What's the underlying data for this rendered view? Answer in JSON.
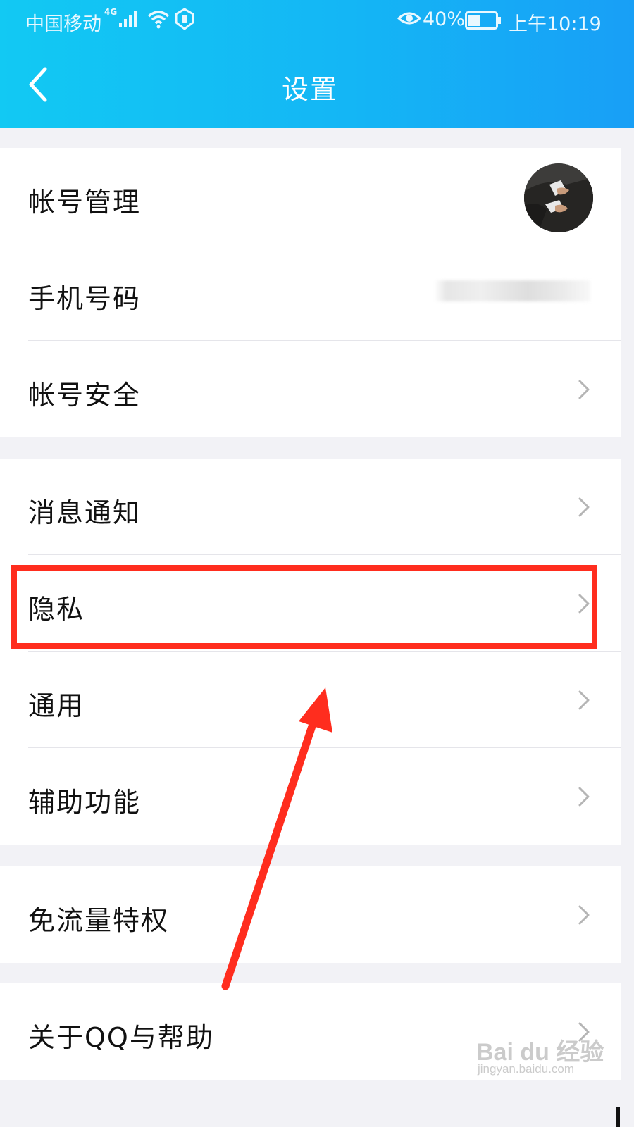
{
  "status_bar": {
    "carrier": "中国移动",
    "network": "4G",
    "battery_pct": "40%",
    "time": "上午10:19"
  },
  "nav": {
    "title": "设置",
    "back_icon": "chevron-left-icon"
  },
  "groups": [
    {
      "items": [
        {
          "label": "帐号管理",
          "accessory": "avatar"
        },
        {
          "label": "手机号码",
          "accessory": "masked-phone"
        },
        {
          "label": "帐号安全",
          "accessory": "chevron"
        }
      ]
    },
    {
      "items": [
        {
          "label": "消息通知",
          "accessory": "chevron"
        },
        {
          "label": "隐私",
          "accessory": "chevron",
          "highlighted": true
        },
        {
          "label": "通用",
          "accessory": "chevron"
        },
        {
          "label": "辅助功能",
          "accessory": "chevron"
        }
      ]
    },
    {
      "items": [
        {
          "label": "免流量特权",
          "accessory": "chevron"
        }
      ]
    },
    {
      "items": [
        {
          "label": "关于QQ与帮助",
          "accessory": "chevron"
        }
      ]
    }
  ],
  "annotation": {
    "highlight_color": "#ff2d1e",
    "arrow_color": "#ff2d1e"
  },
  "watermark": {
    "brand": "Bai du 经验",
    "url": "jingyan.baidu.com"
  },
  "colors": {
    "header_gradient_start": "#12c9f3",
    "header_gradient_end": "#189ff6",
    "page_background": "#f2f2f6",
    "chevron": "#b5b5b5"
  }
}
